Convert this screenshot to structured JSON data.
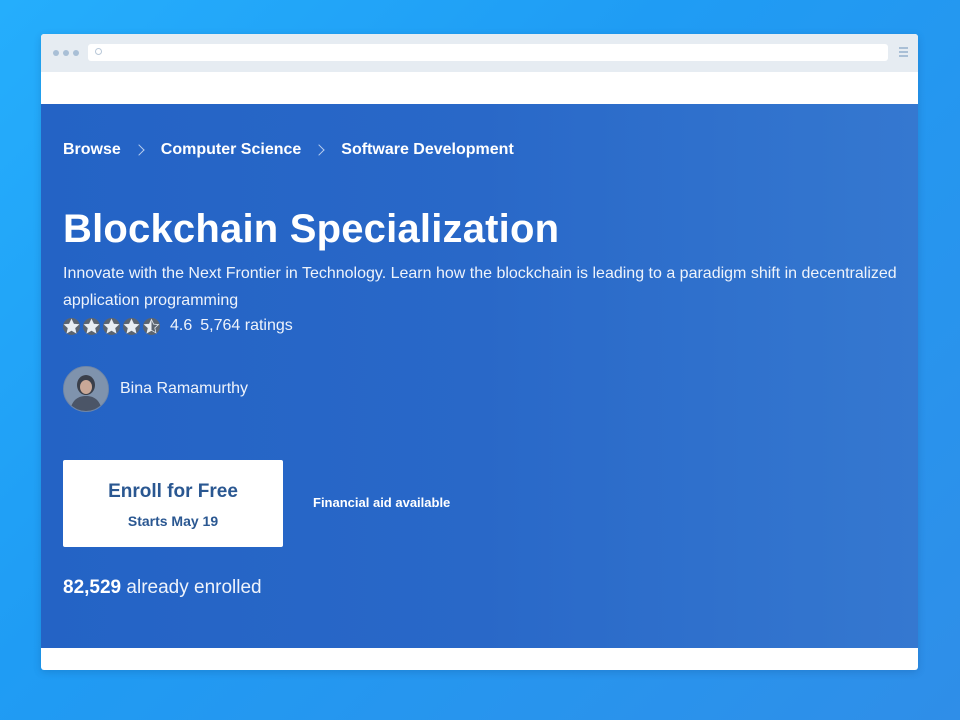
{
  "breadcrumb": {
    "items": [
      "Browse",
      "Computer Science",
      "Software Development"
    ]
  },
  "course": {
    "title": "Blockchain Specialization",
    "subtitle": "Innovate with the Next Frontier in Technology. Learn how the blockchain is leading to a paradigm shift in decentralized application programming",
    "rating_value": "4.6",
    "rating_count": "5,764 ratings",
    "stars": 4.5
  },
  "instructor": {
    "name": "Bina Ramamurthy"
  },
  "enroll": {
    "label": "Enroll for Free",
    "starts": "Starts May 19"
  },
  "financial_aid": "Financial aid available",
  "enrolled": {
    "count": "82,529",
    "suffix": "already enrolled"
  },
  "colors": {
    "hero": "#2463c5",
    "button_text": "#2a5791",
    "background": "#25aefc"
  }
}
